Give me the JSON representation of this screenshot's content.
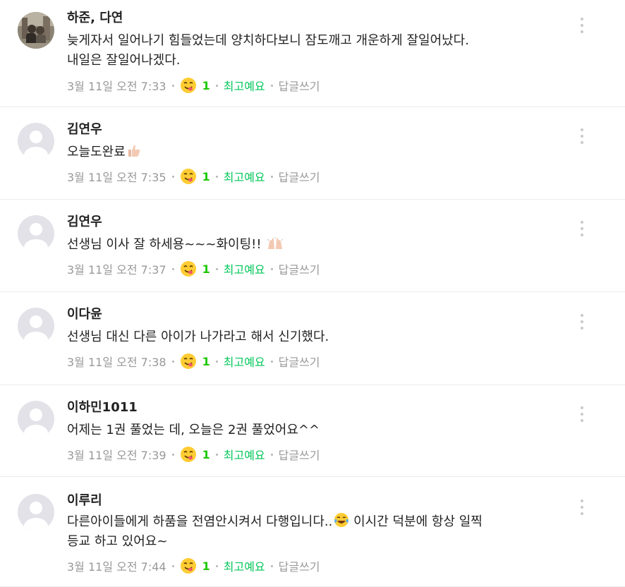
{
  "comments": [
    {
      "author": "하준, 다연",
      "avatar": "photo-avatar",
      "text": "늦게자서 일어나기 힘들었는데 양치하다보니 잠도깨고 개운하게 잘일어났다.\n내일은 잘일어나겠다.",
      "date": "3월 11일 오전 7:33",
      "reaction_icon": "yummy-face-emoji",
      "reaction_count": "1",
      "best_label": "최고예요",
      "reply_label": "답글쓰기"
    },
    {
      "author": "김연우",
      "avatar": "default-avatar",
      "text": "오늘도완료",
      "text_emoji": "thumbs-up-emoji",
      "date": "3월 11일 오전 7:35",
      "reaction_icon": "yummy-face-emoji",
      "reaction_count": "1",
      "best_label": "최고예요",
      "reply_label": "답글쓰기"
    },
    {
      "author": "김연우",
      "avatar": "default-avatar",
      "text": "선생님 이사 잘 하세용~~~화이팅!!",
      "text_emoji": "raised-hands-emoji",
      "date": "3월 11일 오전 7:37",
      "reaction_icon": "yummy-face-emoji",
      "reaction_count": "1",
      "best_label": "최고예요",
      "reply_label": "답글쓰기"
    },
    {
      "author": "이다윤",
      "avatar": "default-avatar",
      "text": "선생님 대신 다른 아이가 나가라고 해서 신기했다.",
      "date": "3월 11일 오전 7:38",
      "reaction_icon": "yummy-face-emoji",
      "reaction_count": "1",
      "best_label": "최고예요",
      "reply_label": "답글쓰기"
    },
    {
      "author": "이하민1011",
      "avatar": "default-avatar",
      "text": "어제는 1권 풀었는 데, 오늘은 2권 풀었어요^^",
      "date": "3월 11일 오전 7:39",
      "reaction_icon": "yummy-face-emoji",
      "reaction_count": "1",
      "best_label": "최고예요",
      "reply_label": "답글쓰기"
    },
    {
      "author": "이루리",
      "avatar": "default-avatar",
      "text_before_emoji": "다른아이들에게 하품을 전염안시켜서 다행입니다..",
      "text_emoji": "tears-of-joy-emoji",
      "text_after_emoji": " 이시간 덕분에 항상 일찍\n등교 하고 있어요~",
      "date": "3월 11일 오전 7:44",
      "reaction_icon": "yummy-face-emoji",
      "reaction_count": "1",
      "best_label": "최고예요",
      "reply_label": "답글쓰기"
    }
  ],
  "colors": {
    "best": "#03c75a",
    "count": "#1ec800",
    "meta": "#999999",
    "divider": "#ececec",
    "avatar_bg": "#e2e2e8"
  }
}
